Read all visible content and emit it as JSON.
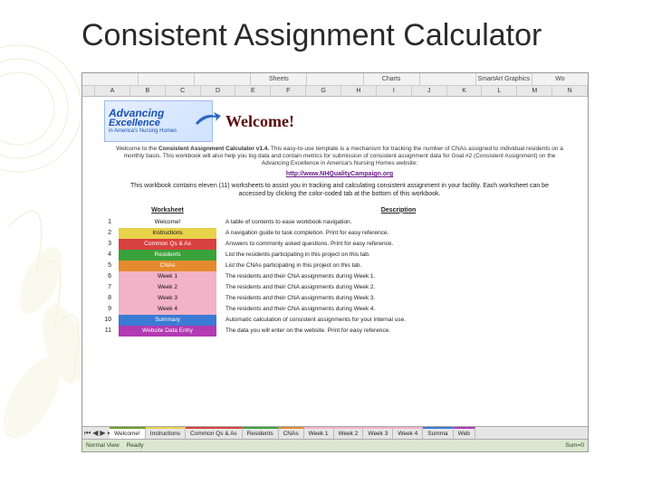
{
  "slide": {
    "title": "Consistent Assignment Calculator"
  },
  "ribbon": {
    "tabs": [
      "",
      "",
      "",
      "Sheets",
      "",
      "Charts",
      "",
      "SmartArt Graphics",
      "Wo"
    ]
  },
  "columns": [
    "",
    "A",
    "B",
    "C",
    "D",
    "E",
    "F",
    "G",
    "H",
    "I",
    "J",
    "K",
    "L",
    "M",
    "N"
  ],
  "logo": {
    "line1": "Advancing",
    "line2": "Excellence",
    "sub": "in America's Nursing Homes"
  },
  "welcome": "Welcome!",
  "intro": {
    "prefix": "Welcome to the ",
    "bold": "Consistent Assignment Calculator v1.4.",
    "rest": " This easy-to-use template is a mechanism for tracking the number of CNAs assigned to individual residents on a monthly basis. This workbook will also help you log data and contain metrics for submission of consistent assignment data for Goal #2 (Consistent Assignment) on the Advancing Excellence in America's Nursing Homes website:"
  },
  "link": "http://www.NHQualityCampaign.org",
  "desc2": "This workbook contains eleven (11) worksheets to assist you in tracking and calculating consistent assignment in your facility. Each worksheet can be accessed by clicking the color-coded tab at the bottom of this workbook.",
  "table": {
    "headers": {
      "worksheet": "Worksheet",
      "description": "Description"
    },
    "rows": [
      {
        "idx": "1",
        "name": "Welcome!",
        "color": "#ffffff",
        "desc": "A table of contents to ease workbook navigation."
      },
      {
        "idx": "2",
        "name": "Instructions",
        "color": "#e8d24a",
        "desc": "A navigation guide to task completion. Print for easy reference."
      },
      {
        "idx": "3",
        "name": "Common Qs & As",
        "color": "#d94141",
        "tc": "#fff",
        "desc": "Answers to commonly asked questions. Print for easy reference."
      },
      {
        "idx": "4",
        "name": "Residents",
        "color": "#3aa23a",
        "tc": "#fff",
        "desc": "List the residents participating in this project on this tab."
      },
      {
        "idx": "5",
        "name": "CNAs",
        "color": "#e58a2e",
        "tc": "#fff",
        "desc": "List the CNAs participating in this project on this tab."
      },
      {
        "idx": "6",
        "name": "Week 1",
        "color": "#f2b2c8",
        "desc": "The residents and their CNA assignments during Week 1."
      },
      {
        "idx": "7",
        "name": "Week 2",
        "color": "#f2b2c8",
        "desc": "The residents and their CNA assignments during Week 2."
      },
      {
        "idx": "8",
        "name": "Week 3",
        "color": "#f2b2c8",
        "desc": "The residents and their CNA assignments during Week 3."
      },
      {
        "idx": "9",
        "name": "Week 4",
        "color": "#f2b2c8",
        "desc": "The residents and their CNA assignments during Week 4."
      },
      {
        "idx": "10",
        "name": "Summary",
        "color": "#3a7bd5",
        "tc": "#fff",
        "desc": "Automatic calculation of consistent assignments for your internal use."
      },
      {
        "idx": "11",
        "name": "Website Data Entry",
        "color": "#b23ab2",
        "tc": "#fff",
        "desc": "The data you will enter on the website. Print for easy reference."
      }
    ]
  },
  "sheetTabs": [
    "Welcome!",
    "Instructions",
    "Common Qs & As",
    "Residents",
    "CNAs",
    "Week 1",
    "Week 2",
    "Week 3",
    "Week 4",
    "Summa",
    "Web"
  ],
  "sheetTabColors": [
    "#ffffff",
    "#e8d24a",
    "#d94141",
    "#3aa23a",
    "#e58a2e",
    "#f2b2c8",
    "#f2b2c8",
    "#f2b2c8",
    "#f2b2c8",
    "#3a7bd5",
    "#b23ab2"
  ],
  "status": {
    "view": "Normal View",
    "ready": "Ready",
    "sum": "Sum=0"
  }
}
